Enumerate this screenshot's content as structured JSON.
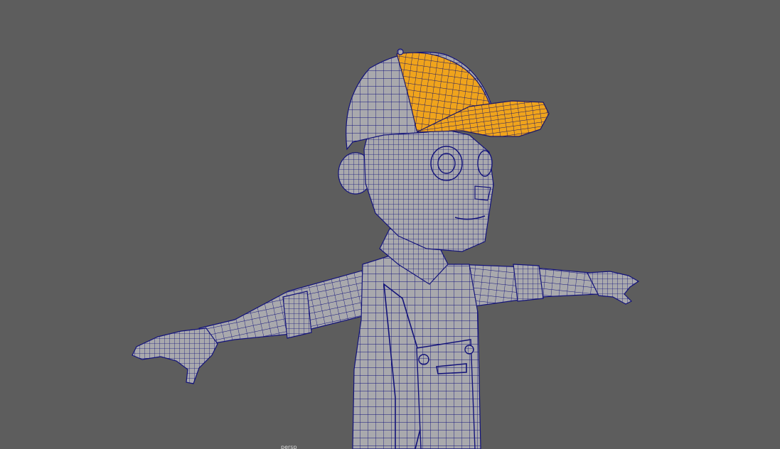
{
  "viewport": {
    "background_color": "#5d5d5d",
    "camera_label": "persp"
  },
  "model": {
    "wire_color": "#13137a",
    "skin_color": "#a9a9ad",
    "selected_color": "#f0a41c",
    "selected_part": "cap",
    "parts": [
      "cap",
      "head",
      "face",
      "ear",
      "neck",
      "torso",
      "left-arm",
      "right-arm",
      "left-hand",
      "right-hand",
      "overalls",
      "pocket",
      "button-left",
      "button-right"
    ]
  }
}
